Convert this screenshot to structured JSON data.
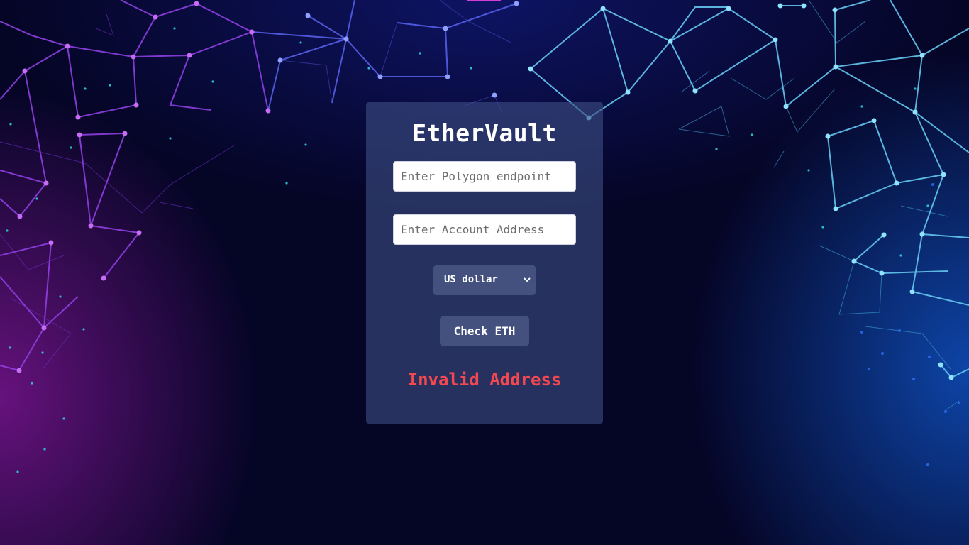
{
  "app": {
    "title": "EtherVault"
  },
  "form": {
    "endpoint_placeholder": "Enter Polygon endpoint",
    "endpoint_value": "",
    "account_placeholder": "Enter Account Address",
    "account_value": "",
    "currency_selected": "US dollar",
    "check_button_label": "Check ETH",
    "status_message": "Invalid Address"
  },
  "colors": {
    "background": "#050526",
    "card": "#3c4e82",
    "button": "#44507e",
    "status_error": "#f3484f",
    "network_left": "#9b4cf0",
    "network_right": "#6fd0f2"
  },
  "icons": {
    "select_arrow": "chevron-down-icon"
  }
}
